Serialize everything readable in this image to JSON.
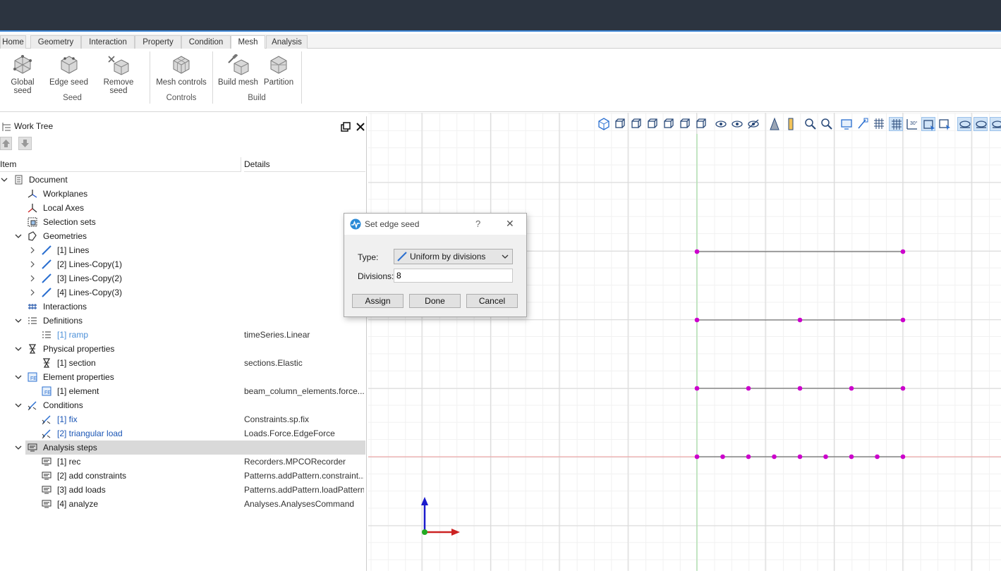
{
  "ribbon_tabs": [
    {
      "label": "Home",
      "active": false
    },
    {
      "label": "Geometry",
      "active": false
    },
    {
      "label": "Interaction",
      "active": false
    },
    {
      "label": "Property",
      "active": false
    },
    {
      "label": "Condition",
      "active": false
    },
    {
      "label": "Mesh",
      "active": true
    },
    {
      "label": "Analysis",
      "active": false
    }
  ],
  "ribbon": {
    "seed": {
      "label": "Seed",
      "global_seed": "Global seed",
      "edge_seed": "Edge seed",
      "remove_seed": "Remove seed"
    },
    "controls": {
      "label": "Controls",
      "mesh_controls": "Mesh controls"
    },
    "build": {
      "label": "Build",
      "build_mesh": "Build mesh",
      "partition": "Partition"
    }
  },
  "work_tree": {
    "title": "Work Tree",
    "col_item": "Item",
    "col_details": "Details",
    "rows": [
      {
        "label": "Document",
        "details": "",
        "level": 0,
        "expander": "open",
        "icon": "document-icon",
        "style": ""
      },
      {
        "label": "Workplanes",
        "details": "",
        "level": 1,
        "expander": "",
        "icon": "workplane-icon",
        "style": ""
      },
      {
        "label": "Local Axes",
        "details": "",
        "level": 1,
        "expander": "",
        "icon": "axes-icon",
        "style": ""
      },
      {
        "label": "Selection sets",
        "details": "",
        "level": 1,
        "expander": "",
        "icon": "selection-set-icon",
        "style": ""
      },
      {
        "label": "Geometries",
        "details": "",
        "level": 1,
        "expander": "open",
        "icon": "geometry-icon",
        "style": ""
      },
      {
        "label": "[1] Lines",
        "details": "",
        "level": 2,
        "expander": "closed",
        "icon": "line-icon",
        "style": ""
      },
      {
        "label": "[2] Lines-Copy(1)",
        "details": "",
        "level": 2,
        "expander": "closed",
        "icon": "line-icon",
        "style": ""
      },
      {
        "label": "[3] Lines-Copy(2)",
        "details": "",
        "level": 2,
        "expander": "closed",
        "icon": "line-icon",
        "style": ""
      },
      {
        "label": "[4] Lines-Copy(3)",
        "details": "",
        "level": 2,
        "expander": "closed",
        "icon": "line-icon",
        "style": ""
      },
      {
        "label": "Interactions",
        "details": "",
        "level": 1,
        "expander": "",
        "icon": "interaction-icon",
        "style": ""
      },
      {
        "label": "Definitions",
        "details": "",
        "level": 1,
        "expander": "open",
        "icon": "list-icon",
        "style": ""
      },
      {
        "label": "[1] ramp",
        "details": "timeSeries.Linear",
        "level": 2,
        "expander": "",
        "icon": "list-icon",
        "style": "lblue"
      },
      {
        "label": "Physical properties",
        "details": "",
        "level": 1,
        "expander": "open",
        "icon": "physical-property-icon",
        "style": ""
      },
      {
        "label": "[1] section",
        "details": "sections.Elastic",
        "level": 2,
        "expander": "",
        "icon": "physical-property-icon",
        "style": ""
      },
      {
        "label": "Element properties",
        "details": "",
        "level": 1,
        "expander": "open",
        "icon": "element-property-icon",
        "style": ""
      },
      {
        "label": "[1] element",
        "details": "beam_column_elements.force...",
        "level": 2,
        "expander": "",
        "icon": "element-property-icon",
        "style": ""
      },
      {
        "label": "Conditions",
        "details": "",
        "level": 1,
        "expander": "open",
        "icon": "condition-icon",
        "style": ""
      },
      {
        "label": "[1] fix",
        "details": "Constraints.sp.fix",
        "level": 2,
        "expander": "",
        "icon": "condition-icon",
        "style": "blue"
      },
      {
        "label": "[2] triangular load",
        "details": "Loads.Force.EdgeForce",
        "level": 2,
        "expander": "",
        "icon": "condition-icon",
        "style": "blue"
      },
      {
        "label": "Analysis steps",
        "details": "",
        "level": 1,
        "expander": "open",
        "icon": "analysis-step-icon",
        "style": "",
        "selected": true
      },
      {
        "label": "[1] rec",
        "details": "Recorders.MPCORecorder",
        "level": 2,
        "expander": "",
        "icon": "analysis-step-icon",
        "style": ""
      },
      {
        "label": "[2] add constraints",
        "details": "Patterns.addPattern.constraint...",
        "level": 2,
        "expander": "",
        "icon": "analysis-step-icon",
        "style": ""
      },
      {
        "label": "[3] add loads",
        "details": "Patterns.addPattern.loadPattern",
        "level": 2,
        "expander": "",
        "icon": "analysis-step-icon",
        "style": ""
      },
      {
        "label": "[4] analyze",
        "details": "Analyses.AnalysesCommand",
        "level": 2,
        "expander": "",
        "icon": "analysis-step-icon",
        "style": ""
      }
    ]
  },
  "dialog": {
    "title": "Set edge seed",
    "help": "?",
    "close": "✕",
    "type_label": "Type:",
    "type_value": "Uniform by divisions",
    "divisions_label": "Divisions:",
    "divisions_value": "8",
    "assign": "Assign",
    "done": "Done",
    "cancel": "Cancel"
  },
  "scene": {
    "edges": [
      {
        "name": "[1] Lines",
        "divisions": 1
      },
      {
        "name": "[2] Lines-Copy(1)",
        "divisions": 2
      },
      {
        "name": "[3] Lines-Copy(2)",
        "divisions": 4
      },
      {
        "name": "[4] Lines-Copy(3)",
        "divisions": 8
      }
    ],
    "seed_color": "#cc00cc",
    "edge_color": "#555555",
    "grid_color": "#e6e6e6",
    "axis_x_color": "#cc2222",
    "axis_y_color": "#1a1acc",
    "axis_z_color": "#22aa22"
  }
}
